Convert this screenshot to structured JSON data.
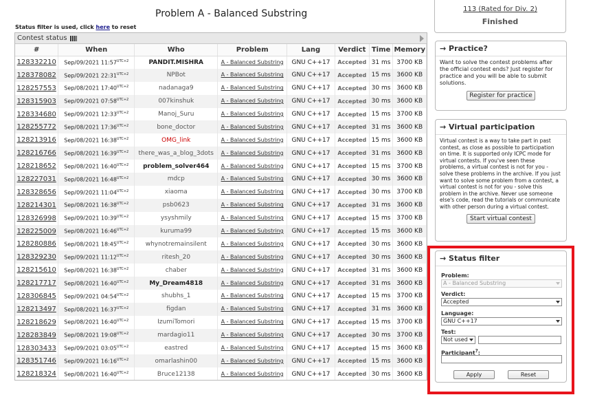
{
  "page": {
    "title": "Problem A - Balanced Substring"
  },
  "filter_note": {
    "prefix": "Status filter is used, click ",
    "link": "here",
    "suffix": " to reset"
  },
  "status": {
    "header": "Contest status",
    "columns": [
      "#",
      "When",
      "Who",
      "Problem",
      "Lang",
      "Verdict",
      "Time",
      "Memory"
    ],
    "rows": [
      {
        "id": "128332210",
        "when": "Sep/09/2021 11:57",
        "who": "PANDIT.MISHRA",
        "who_style": "bold-dark",
        "problem": "A - Balanced Substring",
        "lang": "GNU C++17",
        "verdict": "Accepted",
        "time": "31 ms",
        "memory": "3700 KB"
      },
      {
        "id": "128378082",
        "when": "Sep/09/2021 22:31",
        "who": "NPBot",
        "who_style": "normal",
        "problem": "A - Balanced Substring",
        "lang": "GNU C++17",
        "verdict": "Accepted",
        "time": "15 ms",
        "memory": "3600 KB"
      },
      {
        "id": "128257553",
        "when": "Sep/08/2021 17:40",
        "who": "nadanaga9",
        "who_style": "gray",
        "problem": "A - Balanced Substring",
        "lang": "GNU C++17",
        "verdict": "Accepted",
        "time": "30 ms",
        "memory": "3600 KB"
      },
      {
        "id": "128315903",
        "when": "Sep/09/2021 07:58",
        "who": "007kinshuk",
        "who_style": "gray",
        "problem": "A - Balanced Substring",
        "lang": "GNU C++17",
        "verdict": "Accepted",
        "time": "30 ms",
        "memory": "3600 KB"
      },
      {
        "id": "128334680",
        "when": "Sep/09/2021 12:33",
        "who": "Manoj_Suru",
        "who_style": "gray",
        "problem": "A - Balanced Substring",
        "lang": "GNU C++17",
        "verdict": "Accepted",
        "time": "15 ms",
        "memory": "3700 KB"
      },
      {
        "id": "128255772",
        "when": "Sep/08/2021 17:36",
        "who": "bone_doctor",
        "who_style": "gray",
        "problem": "A - Balanced Substring",
        "lang": "GNU C++17",
        "verdict": "Accepted",
        "time": "31 ms",
        "memory": "3600 KB"
      },
      {
        "id": "128213916",
        "when": "Sep/08/2021 16:38",
        "who": "OMG_link",
        "who_style": "red",
        "problem": "A - Balanced Substring",
        "lang": "GNU C++17",
        "verdict": "Accepted",
        "time": "15 ms",
        "memory": "3600 KB"
      },
      {
        "id": "128216766",
        "when": "Sep/08/2021 16:39",
        "who": "there_was_a_blog_3dots",
        "who_style": "gray",
        "problem": "A - Balanced Substring",
        "lang": "GNU C++17",
        "verdict": "Accepted",
        "time": "31 ms",
        "memory": "3600 KB"
      },
      {
        "id": "128218652",
        "when": "Sep/08/2021 16:40",
        "who": "problem_solver464",
        "who_style": "bold-dark",
        "problem": "A - Balanced Substring",
        "lang": "GNU C++17",
        "verdict": "Accepted",
        "time": "15 ms",
        "memory": "3700 KB"
      },
      {
        "id": "128227031",
        "when": "Sep/08/2021 16:48",
        "who": "mdcp",
        "who_style": "gray",
        "problem": "A - Balanced Substring",
        "lang": "GNU C++17",
        "verdict": "Accepted",
        "time": "30 ms",
        "memory": "3600 KB"
      },
      {
        "id": "128328656",
        "when": "Sep/09/2021 11:04",
        "who": "xiaoma",
        "who_style": "gray",
        "problem": "A - Balanced Substring",
        "lang": "GNU C++17",
        "verdict": "Accepted",
        "time": "30 ms",
        "memory": "3700 KB"
      },
      {
        "id": "128214301",
        "when": "Sep/08/2021 16:38",
        "who": "psb0623",
        "who_style": "gray",
        "problem": "A - Balanced Substring",
        "lang": "GNU C++17",
        "verdict": "Accepted",
        "time": "31 ms",
        "memory": "3600 KB"
      },
      {
        "id": "128326998",
        "when": "Sep/09/2021 10:39",
        "who": "ysyshmily",
        "who_style": "gray",
        "problem": "A - Balanced Substring",
        "lang": "GNU C++17",
        "verdict": "Accepted",
        "time": "15 ms",
        "memory": "3700 KB"
      },
      {
        "id": "128225009",
        "when": "Sep/08/2021 16:46",
        "who": "kuruma99",
        "who_style": "gray",
        "problem": "A - Balanced Substring",
        "lang": "GNU C++17",
        "verdict": "Accepted",
        "time": "15 ms",
        "memory": "3600 KB"
      },
      {
        "id": "128280886",
        "when": "Sep/08/2021 18:45",
        "who": "whynotremainsilent",
        "who_style": "gray",
        "problem": "A - Balanced Substring",
        "lang": "GNU C++17",
        "verdict": "Accepted",
        "time": "30 ms",
        "memory": "3600 KB"
      },
      {
        "id": "128329230",
        "when": "Sep/09/2021 11:12",
        "who": "ritesh_20",
        "who_style": "gray",
        "problem": "A - Balanced Substring",
        "lang": "GNU C++17",
        "verdict": "Accepted",
        "time": "30 ms",
        "memory": "3600 KB"
      },
      {
        "id": "128215610",
        "when": "Sep/08/2021 16:38",
        "who": "chaber",
        "who_style": "gray",
        "problem": "A - Balanced Substring",
        "lang": "GNU C++17",
        "verdict": "Accepted",
        "time": "31 ms",
        "memory": "3600 KB"
      },
      {
        "id": "128217717",
        "when": "Sep/08/2021 16:40",
        "who": "My_Dream4818",
        "who_style": "bold-dark",
        "problem": "A - Balanced Substring",
        "lang": "GNU C++17",
        "verdict": "Accepted",
        "time": "31 ms",
        "memory": "3600 KB"
      },
      {
        "id": "128306845",
        "when": "Sep/09/2021 04:54",
        "who": "shubhs_1",
        "who_style": "gray",
        "problem": "A - Balanced Substring",
        "lang": "GNU C++17",
        "verdict": "Accepted",
        "time": "15 ms",
        "memory": "3700 KB"
      },
      {
        "id": "128213497",
        "when": "Sep/08/2021 16:37",
        "who": "figdan",
        "who_style": "gray",
        "problem": "A - Balanced Substring",
        "lang": "GNU C++17",
        "verdict": "Accepted",
        "time": "31 ms",
        "memory": "3600 KB"
      },
      {
        "id": "128218629",
        "when": "Sep/08/2021 16:40",
        "who": "IzumiTomori",
        "who_style": "gray",
        "problem": "A - Balanced Substring",
        "lang": "GNU C++17",
        "verdict": "Accepted",
        "time": "15 ms",
        "memory": "3700 KB"
      },
      {
        "id": "128283849",
        "when": "Sep/08/2021 19:08",
        "who": "mardagio11",
        "who_style": "gray",
        "problem": "A - Balanced Substring",
        "lang": "GNU C++17",
        "verdict": "Accepted",
        "time": "30 ms",
        "memory": "3700 KB"
      },
      {
        "id": "128303433",
        "when": "Sep/09/2021 03:05",
        "who": "eastred",
        "who_style": "gray",
        "problem": "A - Balanced Substring",
        "lang": "GNU C++17",
        "verdict": "Accepted",
        "time": "15 ms",
        "memory": "3600 KB"
      },
      {
        "id": "128351746",
        "when": "Sep/09/2021 16:16",
        "who": "omarlashin00",
        "who_style": "gray",
        "problem": "A - Balanced Substring",
        "lang": "GNU C++17",
        "verdict": "Accepted",
        "time": "15 ms",
        "memory": "3600 KB"
      },
      {
        "id": "128218324",
        "when": "Sep/08/2021 16:40",
        "who": "Bruce12138",
        "who_style": "gray",
        "problem": "A - Balanced Substring",
        "lang": "GNU C++17",
        "verdict": "Accepted",
        "time": "30 ms",
        "memory": "3600 KB"
      }
    ],
    "utc_suffix": "UTC+2"
  },
  "sidebar": {
    "contest_info": {
      "rated": "113 (Rated for Div. 2)",
      "state": "Finished"
    },
    "practice": {
      "title": "→ Practice?",
      "text": "Want to solve the contest problems after the official contest ends? Just register for practice and you will be able to submit solutions.",
      "button": "Register for practice"
    },
    "virtual": {
      "title": "→ Virtual participation",
      "text": "Virtual contest is a way to take part in past contest, as close as possible to participation on time. It is supported only ICPC mode for virtual contests. If you've seen these problems, a virtual contest is not for you - solve these problems in the archive. If you just want to solve some problem from a contest, a virtual contest is not for you - solve this problem in the archive. Never use someone else's code, read the tutorials or communicate with other person during a virtual contest.",
      "button": "Start virtual contest"
    },
    "status_filter": {
      "title": "→ Status filter",
      "problem_label": "Problem:",
      "problem_value": "A - Balanced Substring",
      "verdict_label": "Verdict:",
      "verdict_value": "Accepted",
      "language_label": "Language:",
      "language_value": "GNU C++17",
      "test_label": "Test:",
      "test_value": "Not used",
      "participant_label": "Participant",
      "apply": "Apply",
      "reset": "Reset"
    }
  },
  "colors": {
    "highlight_frame": "#e8141b",
    "red_handle": "#cc0000"
  }
}
